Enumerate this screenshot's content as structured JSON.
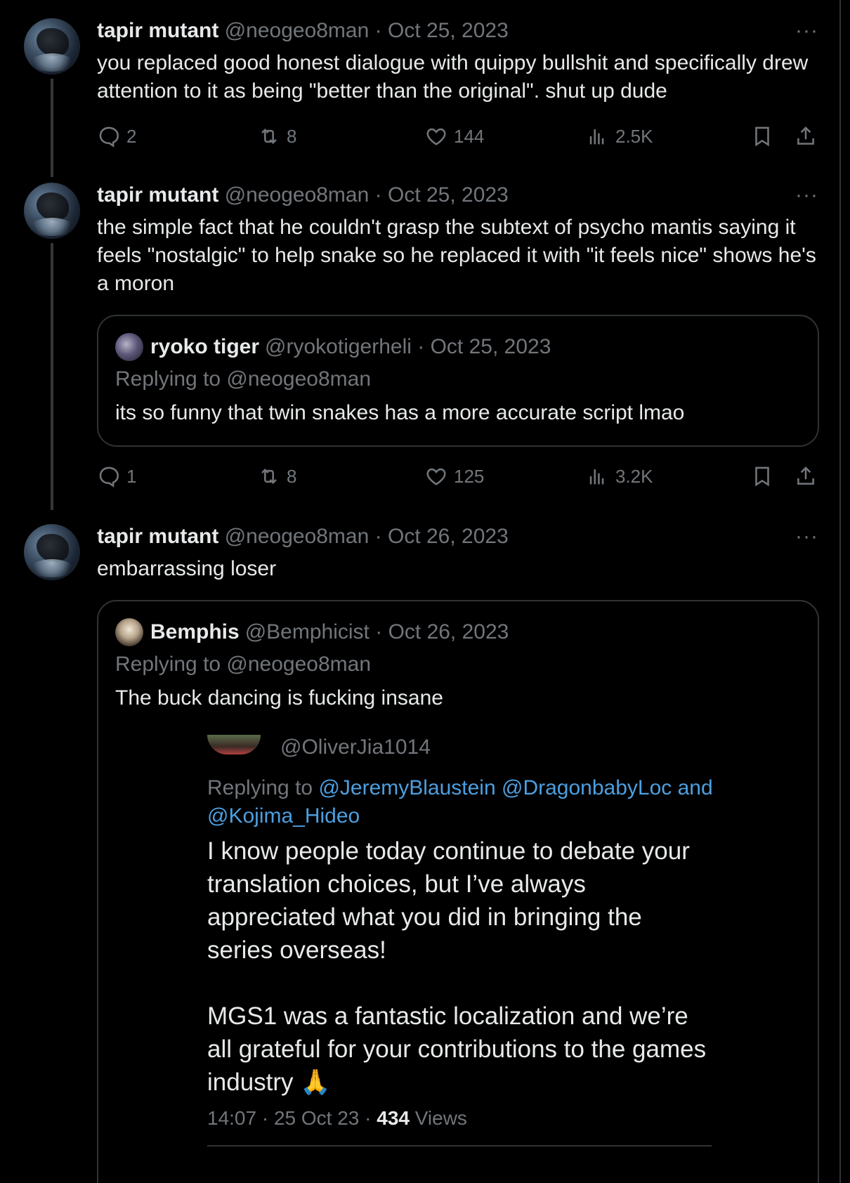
{
  "tweets": [
    {
      "name": "tapir mutant",
      "handle": "@neogeo8man",
      "date": "Oct 25, 2023",
      "more": "···",
      "text": "you replaced good honest dialogue with quippy bullshit and specifically drew attention to it as being \"better than the original\". shut up dude",
      "replies": "2",
      "reposts": "8",
      "likes": "144",
      "views": "2.5K"
    },
    {
      "name": "tapir mutant",
      "handle": "@neogeo8man",
      "date": "Oct 25, 2023",
      "more": "···",
      "text": "the simple fact that he couldn't grasp the subtext of psycho mantis saying it feels \"nostalgic\" to help snake so he replaced it with \"it feels nice\" shows he's a moron",
      "replies": "1",
      "reposts": "8",
      "likes": "125",
      "views": "3.2K",
      "quote": {
        "name": "ryoko tiger",
        "handle": "@ryokotigerheli",
        "date": "Oct 25, 2023",
        "replying": "Replying to @neogeo8man",
        "text": "its so funny that twin snakes has a more accurate script lmao"
      }
    },
    {
      "name": "tapir mutant",
      "handle": "@neogeo8man",
      "date": "Oct 26, 2023",
      "more": "···",
      "text": "embarrassing loser",
      "quote": {
        "name": "Bemphis",
        "handle": "@Bemphicist",
        "date": "Oct 26, 2023",
        "replying": "Replying to @neogeo8man",
        "text": "The buck dancing is fucking insane",
        "embed": {
          "handle": "@OliverJia1014",
          "replying_prefix": "Replying to",
          "mentions": "@JeremyBlaustein @DragonbabyLoc and @Kojima_Hideo",
          "para1": "I know people today continue to debate your translation choices, but I’ve always appreciated what you did in bringing the series overseas!",
          "para2": "MGS1 was a fantastic localization and we’re all grateful for your contributions to the games industry 🙏",
          "time": "14:07 · 25 Oct 23 ·",
          "views_count": "434",
          "views_label": "Views"
        }
      }
    }
  ]
}
